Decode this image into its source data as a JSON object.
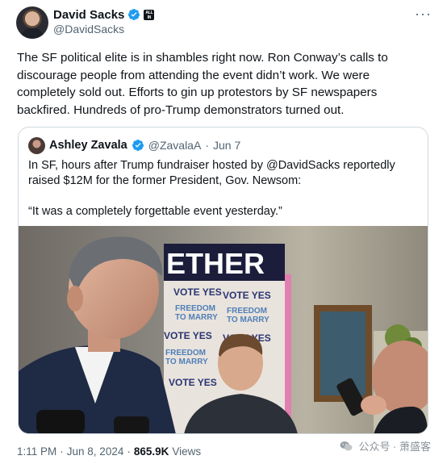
{
  "author": {
    "display_name": "David Sacks",
    "handle": "@DavidSacks",
    "affiliate_badge": "ALL IN"
  },
  "menu": {
    "more_label": "···"
  },
  "tweet": {
    "text": "The SF political elite is in shambles right now. Ron Conway’s calls to discourage people from attending the event didn’t work. We were completely sold out. Efforts to gin up protestors by SF newspapers backfired. Hundreds of pro-Trump demonstrators turned out."
  },
  "quoted_tweet": {
    "display_name": "Ashley Zavala",
    "handle": "@ZavalaA",
    "separator": "·",
    "date": "Jun 7",
    "text_paragraph_1": "In SF, hours after Trump fundraiser hosted by @DavidSacks reportedly raised $12M for the former President, Gov. Newsom:",
    "text_paragraph_2": "“It was a completely forgettable event yesterday.”",
    "media": {
      "banner_text": "ETHER",
      "sign_lines": {
        "vote_yes": "VOTE YES",
        "freedom": "FREEDOM",
        "to_marry": "TO MARRY"
      }
    }
  },
  "footer": {
    "time": "1:11 PM",
    "separator": "·",
    "date": "Jun 8, 2024",
    "separator2": "·",
    "views_count": "865.9K",
    "views_label": "Views"
  },
  "watermark": {
    "text": "公众号 · 萧盛客"
  },
  "colors": {
    "verified_blue": "#1d9bf0",
    "secondary_text": "#536471",
    "border": "#cfd9de"
  },
  "icons": [
    "verified-badge-icon",
    "more-icon",
    "wechat-icon"
  ]
}
